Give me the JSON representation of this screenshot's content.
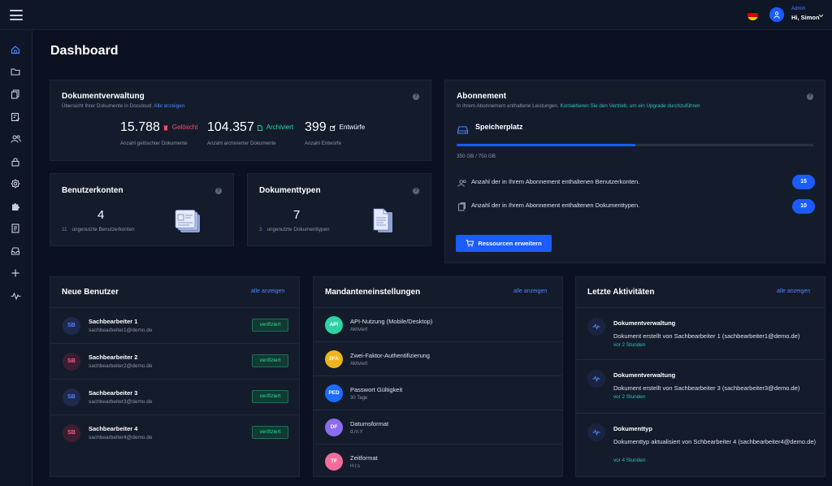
{
  "header": {
    "user_role": "Admin",
    "user_greeting": "Hi, Simon"
  },
  "page_title": "Dashboard",
  "doc_mgmt": {
    "title": "Dokumentverwaltung",
    "subtitle": "Übersicht Ihrer Dokumente in Doculoud.",
    "subtitle_link": "Alle anzeigen",
    "stats": [
      {
        "value": "15.788",
        "tag": "Gelöscht",
        "label": "Anzahl gelöschter Dokumente",
        "color": "#ff4d5e"
      },
      {
        "value": "104.357",
        "tag": "Archiviert",
        "label": "Anzahl archivierter Dokumente",
        "color": "#33d69f"
      },
      {
        "value": "399",
        "tag": "Entwürfe",
        "label": "Anzahl Entwürfe",
        "color": "#ffffff"
      }
    ]
  },
  "user_accounts": {
    "title": "Benutzerkonten",
    "count": "4",
    "unused_count": "11",
    "unused_label": "ungenutzte Benutzerkonten"
  },
  "doc_types": {
    "title": "Dokumenttypen",
    "count": "7",
    "unused_count": "3",
    "unused_label": "ungenutzte Dokumenttypen"
  },
  "subscription": {
    "title": "Abonnement",
    "subtitle": "In Ihrem Abonnement enthaltene Leistungen.",
    "subtitle_link": "Kontaktieren Sie den Vertrieb, um ein Upgrade durchzuführen",
    "storage_label": "Speicherplatz",
    "storage_value": "350 GB / 750 GB",
    "storage_fraction": 0.5,
    "features": [
      {
        "label": "Anzahl der in Ihrem Abonnement enthaltenen Benutzerkonten.",
        "value": "15"
      },
      {
        "label": "Anzahl der in Ihrem Abonnement enthaltenen Dokumenttypen.",
        "value": "10"
      }
    ],
    "button_label": "Ressourcen erweitern"
  },
  "new_users": {
    "title": "Neue Benutzer",
    "all_link": "alle anzeigen",
    "items": [
      {
        "initials": "SB",
        "name": "Sachbearbeiter 1",
        "email": "sachbearbeiter1@demo.de",
        "status": "verifiziert",
        "bg": "#1d2a4d",
        "fg": "#4d86ff"
      },
      {
        "initials": "SB",
        "name": "Sachbearbeiter 2",
        "email": "sachbearbeiter2@demo.de",
        "status": "verifiziert",
        "bg": "#3a1f33",
        "fg": "#ff5c8a"
      },
      {
        "initials": "SB",
        "name": "Sachbearbeiter 3",
        "email": "sachbearbeiter3@demo.de",
        "status": "verifiziert",
        "bg": "#1d2a4d",
        "fg": "#4d86ff"
      },
      {
        "initials": "SB",
        "name": "Sachbearbeiter 4",
        "email": "sachbearbeiter4@demo.de",
        "status": "verifiziert",
        "bg": "#3a1f33",
        "fg": "#ff5c8a"
      }
    ]
  },
  "tenant_settings": {
    "title": "Mandanteneinstellungen",
    "all_link": "alle anzeigen",
    "items": [
      {
        "code": "API",
        "title": "API-Nutzung (Mobile/Desktop)",
        "value": "Aktiviert",
        "color": "#2ed3a4"
      },
      {
        "code": "2FA",
        "title": "Zwei-Faktor-Authentifizierung",
        "value": "Aktiviert",
        "color": "#f0b51c"
      },
      {
        "code": "PED",
        "title": "Passwort Gültigkeit",
        "value": "30 Tage",
        "color": "#1b6cff"
      },
      {
        "code": "DF",
        "title": "Datumsformat",
        "value": "d.m.Y",
        "color": "#8c6cf2"
      },
      {
        "code": "TF",
        "title": "Zeitformat",
        "value": "H:i:s",
        "color": "#f26d9c"
      }
    ]
  },
  "activities": {
    "title": "Letzte Aktivitäten",
    "all_link": "alle anzeigen",
    "items": [
      {
        "title": "Dokumentverwaltung",
        "description": "Dokument erstellt von Sachbearbeiter 1 (sachbearbeiter1@demo.de)",
        "time": "vor 2 Stunden"
      },
      {
        "title": "Dokumentverwaltung",
        "description": "Dokument erstellt von Sachbearbeiter 3 (sachbearbeiter3@demo.de)",
        "time": "vor 2 Stunden"
      },
      {
        "title": "Dokumenttyp",
        "description": "Dokumenttyp aktualisiert von Schbearbeiter 4 (sachbearbeiter4@demo.de)",
        "time": "vor 4 Stunden"
      }
    ]
  },
  "sidebar_icons": [
    "home-icon",
    "folder-icon",
    "documents-icon",
    "checklist-icon",
    "users-icon",
    "lock-icon",
    "settings-icon",
    "plugin-icon",
    "report-icon",
    "inbox-icon",
    "plus-icon",
    "activity-icon"
  ]
}
